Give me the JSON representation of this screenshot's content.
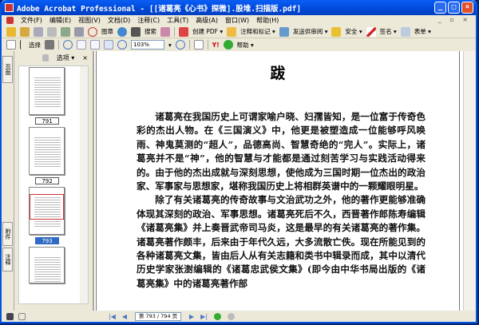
{
  "window": {
    "title": "Adobe Acrobat Professional - [[诸葛亮《心书》探微].股堆.扫描版.pdf]"
  },
  "menu": [
    "文件(F)",
    "编辑(E)",
    "视图(V)",
    "文档(D)",
    "注释(C)",
    "工具(T)",
    "高级(A)",
    "窗口(W)",
    "帮助(H)"
  ],
  "toolbar1": {
    "stamp": "图章",
    "search": "搜索",
    "create_pdf": "创建 PDF ▾",
    "comment": "注释和标记 ▾",
    "review": "发送供审阅 ▾",
    "security": "安全 ▾",
    "sign": "签名 ▾",
    "forms": "表单 ▾"
  },
  "toolbar2": {
    "select": "选择",
    "zoom": "103%",
    "help": "帮助 ▾"
  },
  "panel": {
    "options": "选项 ▾",
    "close": "×",
    "tabs": [
      "页面",
      "附件",
      "注释"
    ],
    "thumbs": [
      {
        "label": "791"
      },
      {
        "label": "792"
      },
      {
        "label": "793"
      }
    ]
  },
  "doc": {
    "title": "跋",
    "paragraphs": [
      "诸葛亮在我国历史上可谓家喻户晓、妇孺皆知，是一位富于传奇色彩的杰出人物。在《三国演义》中，他更是被塑造成一位能够呼风唤雨、神鬼莫测的“超人”，品德高尚、智慧奇绝的“完人”。实际上，诸葛亮并不是“神”，他的智慧与才能都是通过刻苦学习与实践活动得来的。由于他的杰出成就与深刻思想，使他成为三国时期一位杰出的政治家、军事家与思想家，堪称我国历史上将相群英谱中的一颗耀眼明星。",
      "除了有关诸葛亮的传奇故事与文治武功之外，他的著作更能够准确体现其深刻的政治、军事思想。诸葛亮死后不久，西晋著作郎陈寿编辑《诸葛亮集》并上奏晋武帝司马炎，这是最早的有关诸葛亮的著作集。诸葛亮著作颇丰，后来由于年代久远，大多流散亡佚。现在所能见到的各种诸葛亮文集，皆由后人从有关志籍和类书中辑录而成，其中以清代历史学家张澍编辑的《诸葛忠武侯文集》(即今由中华书局出版的《诸葛亮集》中的诸葛亮著作部"
    ]
  },
  "status": {
    "page": "第 793 / 794 页"
  }
}
